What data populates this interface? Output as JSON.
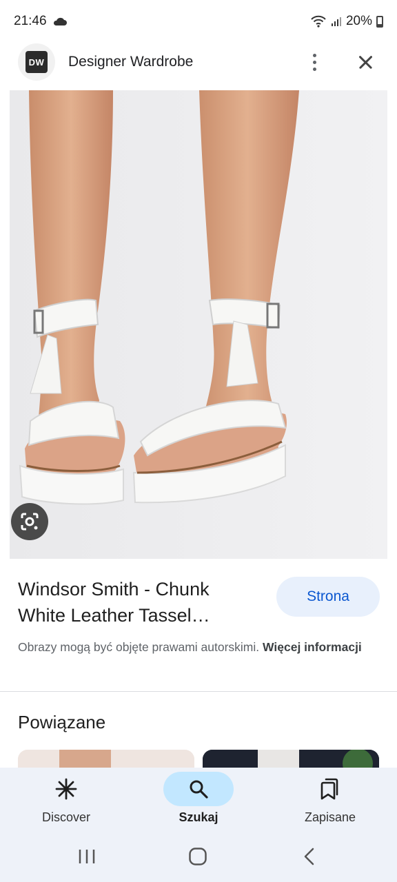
{
  "status": {
    "time": "21:46",
    "battery": "20%"
  },
  "header": {
    "logo_text": "DW",
    "site_name": "Designer Wardrobe"
  },
  "result": {
    "title": "Windsor Smith - Chunk White Leather Tassel…",
    "visit_label": "Strona",
    "copyright_text": "Obrazy mogą być objęte prawami autorskimi.",
    "more_info_label": "Więcej informacji"
  },
  "related": {
    "title": "Powiązane"
  },
  "bottom_nav": {
    "items": [
      {
        "label": "Discover",
        "icon": "asterisk-icon"
      },
      {
        "label": "Szukaj",
        "icon": "search-icon"
      },
      {
        "label": "Zapisane",
        "icon": "bookmarks-icon"
      }
    ]
  }
}
